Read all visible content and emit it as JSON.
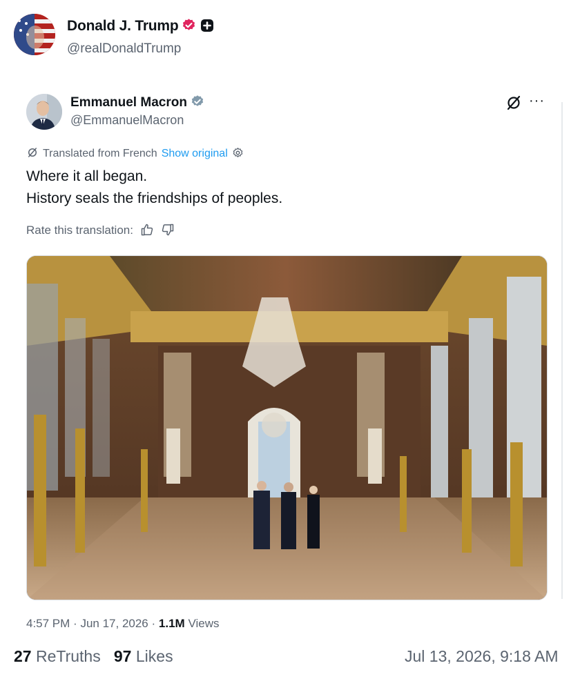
{
  "post": {
    "author_name": "Donald J. Trump",
    "author_handle": "@realDonaldTrump",
    "retruths_count": "27",
    "retruths_label": "ReTruths",
    "likes_count": "97",
    "likes_label": "Likes",
    "timestamp": "Jul 13, 2026, 9:18 AM"
  },
  "embedded_tweet": {
    "author_name": "Emmanuel Macron",
    "author_handle": "@EmmanuelMacron",
    "translated_label": "Translated from French",
    "show_original_label": "Show original",
    "text_line_1": "Where it all began.",
    "text_line_2": "History seals the friendships of peoples.",
    "rate_label": "Rate this translation:",
    "time": "4:57 PM",
    "date": "Jun 17, 2026",
    "separator": "·",
    "views_count": "1.1M",
    "views_label": "Views"
  },
  "icons": {
    "verified_outer": "verified-badge-icon",
    "plus": "plus-badge-icon",
    "verified_inner": "verified-check-icon",
    "grok": "grok-icon",
    "more": "more-icon",
    "translate": "translate-icon",
    "settings": "settings-icon",
    "thumbs_up": "thumbs-up-icon",
    "thumbs_down": "thumbs-down-icon"
  },
  "colors": {
    "link": "#1d9bf0",
    "verified_outer": "#e0245e",
    "verified_inner": "#829aab",
    "muted_text": "#5b6470"
  }
}
